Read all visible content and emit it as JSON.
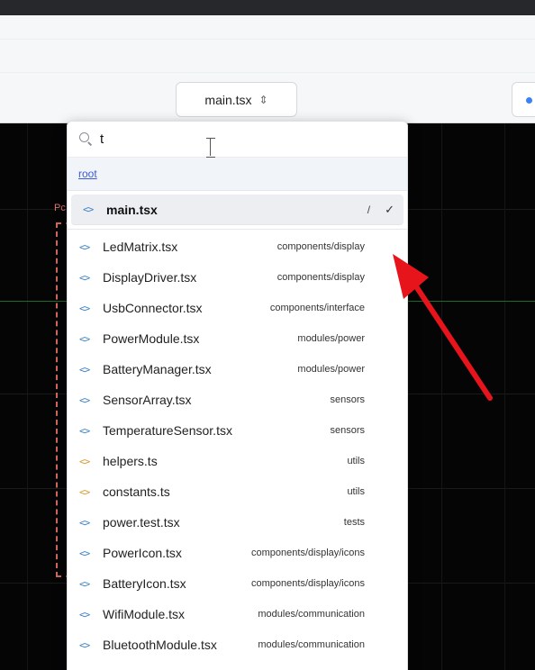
{
  "toolbar": {
    "file_select_value": "main.tsx",
    "file_select_icon": "chevron-updown-icon",
    "status_dot_color": "#3b82f6"
  },
  "canvas": {
    "pcb_label": "Pc"
  },
  "dropdown": {
    "search_value": "t",
    "root_link": "root",
    "current_file": {
      "name": "main.tsx",
      "path": "/",
      "icon": "code-brackets-icon",
      "selected": true
    },
    "files": [
      {
        "name": "LedMatrix.tsx",
        "path": "components/display",
        "icon_color": "#3b82c4"
      },
      {
        "name": "DisplayDriver.tsx",
        "path": "components/display",
        "icon_color": "#3b82c4"
      },
      {
        "name": "UsbConnector.tsx",
        "path": "components/interface",
        "icon_color": "#3b82c4"
      },
      {
        "name": "PowerModule.tsx",
        "path": "modules/power",
        "icon_color": "#3b82c4"
      },
      {
        "name": "BatteryManager.tsx",
        "path": "modules/power",
        "icon_color": "#3b82c4"
      },
      {
        "name": "SensorArray.tsx",
        "path": "sensors",
        "icon_color": "#3b82c4"
      },
      {
        "name": "TemperatureSensor.tsx",
        "path": "sensors",
        "icon_color": "#3b82c4"
      },
      {
        "name": "helpers.ts",
        "path": "utils",
        "icon_color": "#d69a2d"
      },
      {
        "name": "constants.ts",
        "path": "utils",
        "icon_color": "#d69a2d"
      },
      {
        "name": "power.test.tsx",
        "path": "tests",
        "icon_color": "#3b82c4"
      },
      {
        "name": "PowerIcon.tsx",
        "path": "components/display/icons",
        "icon_color": "#3b82c4"
      },
      {
        "name": "BatteryIcon.tsx",
        "path": "components/display/icons",
        "icon_color": "#3b82c4"
      },
      {
        "name": "WifiModule.tsx",
        "path": "modules/communication",
        "icon_color": "#3b82c4"
      },
      {
        "name": "BluetoothModule.tsx",
        "path": "modules/communication",
        "icon_color": "#3b82c4"
      }
    ]
  },
  "annotation": {
    "arrow_color": "#e8141b"
  }
}
